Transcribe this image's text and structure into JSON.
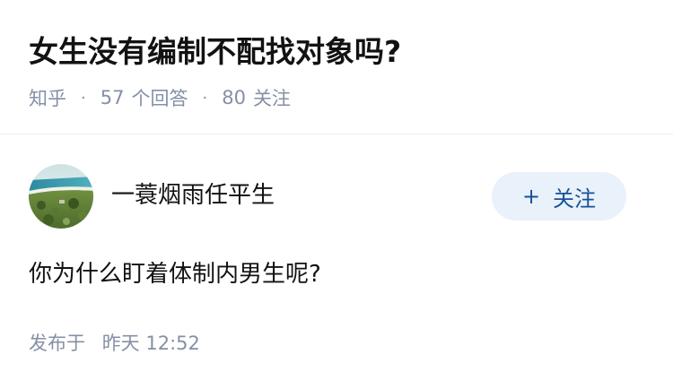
{
  "question": {
    "title": "女生没有编制不配找对象吗?",
    "source": "知乎",
    "separator": "·",
    "answer_count": "57",
    "answer_count_label": "个回答",
    "follower_count": "80",
    "follower_count_label": "关注"
  },
  "answer": {
    "author": {
      "name": "一蓑烟雨任平生",
      "avatar_icon": "landscape-avatar"
    },
    "follow_button": {
      "plus": "+",
      "label": "关注"
    },
    "content": "你为什么盯着体制内男生呢?",
    "publish_label": "发布于",
    "publish_day": "昨天",
    "publish_time": "12:52"
  },
  "colors": {
    "text_primary": "#121212",
    "text_meta": "#8590a6",
    "follow_bg": "#e9f1fb",
    "follow_text": "#175199",
    "divider": "#ebebeb"
  }
}
